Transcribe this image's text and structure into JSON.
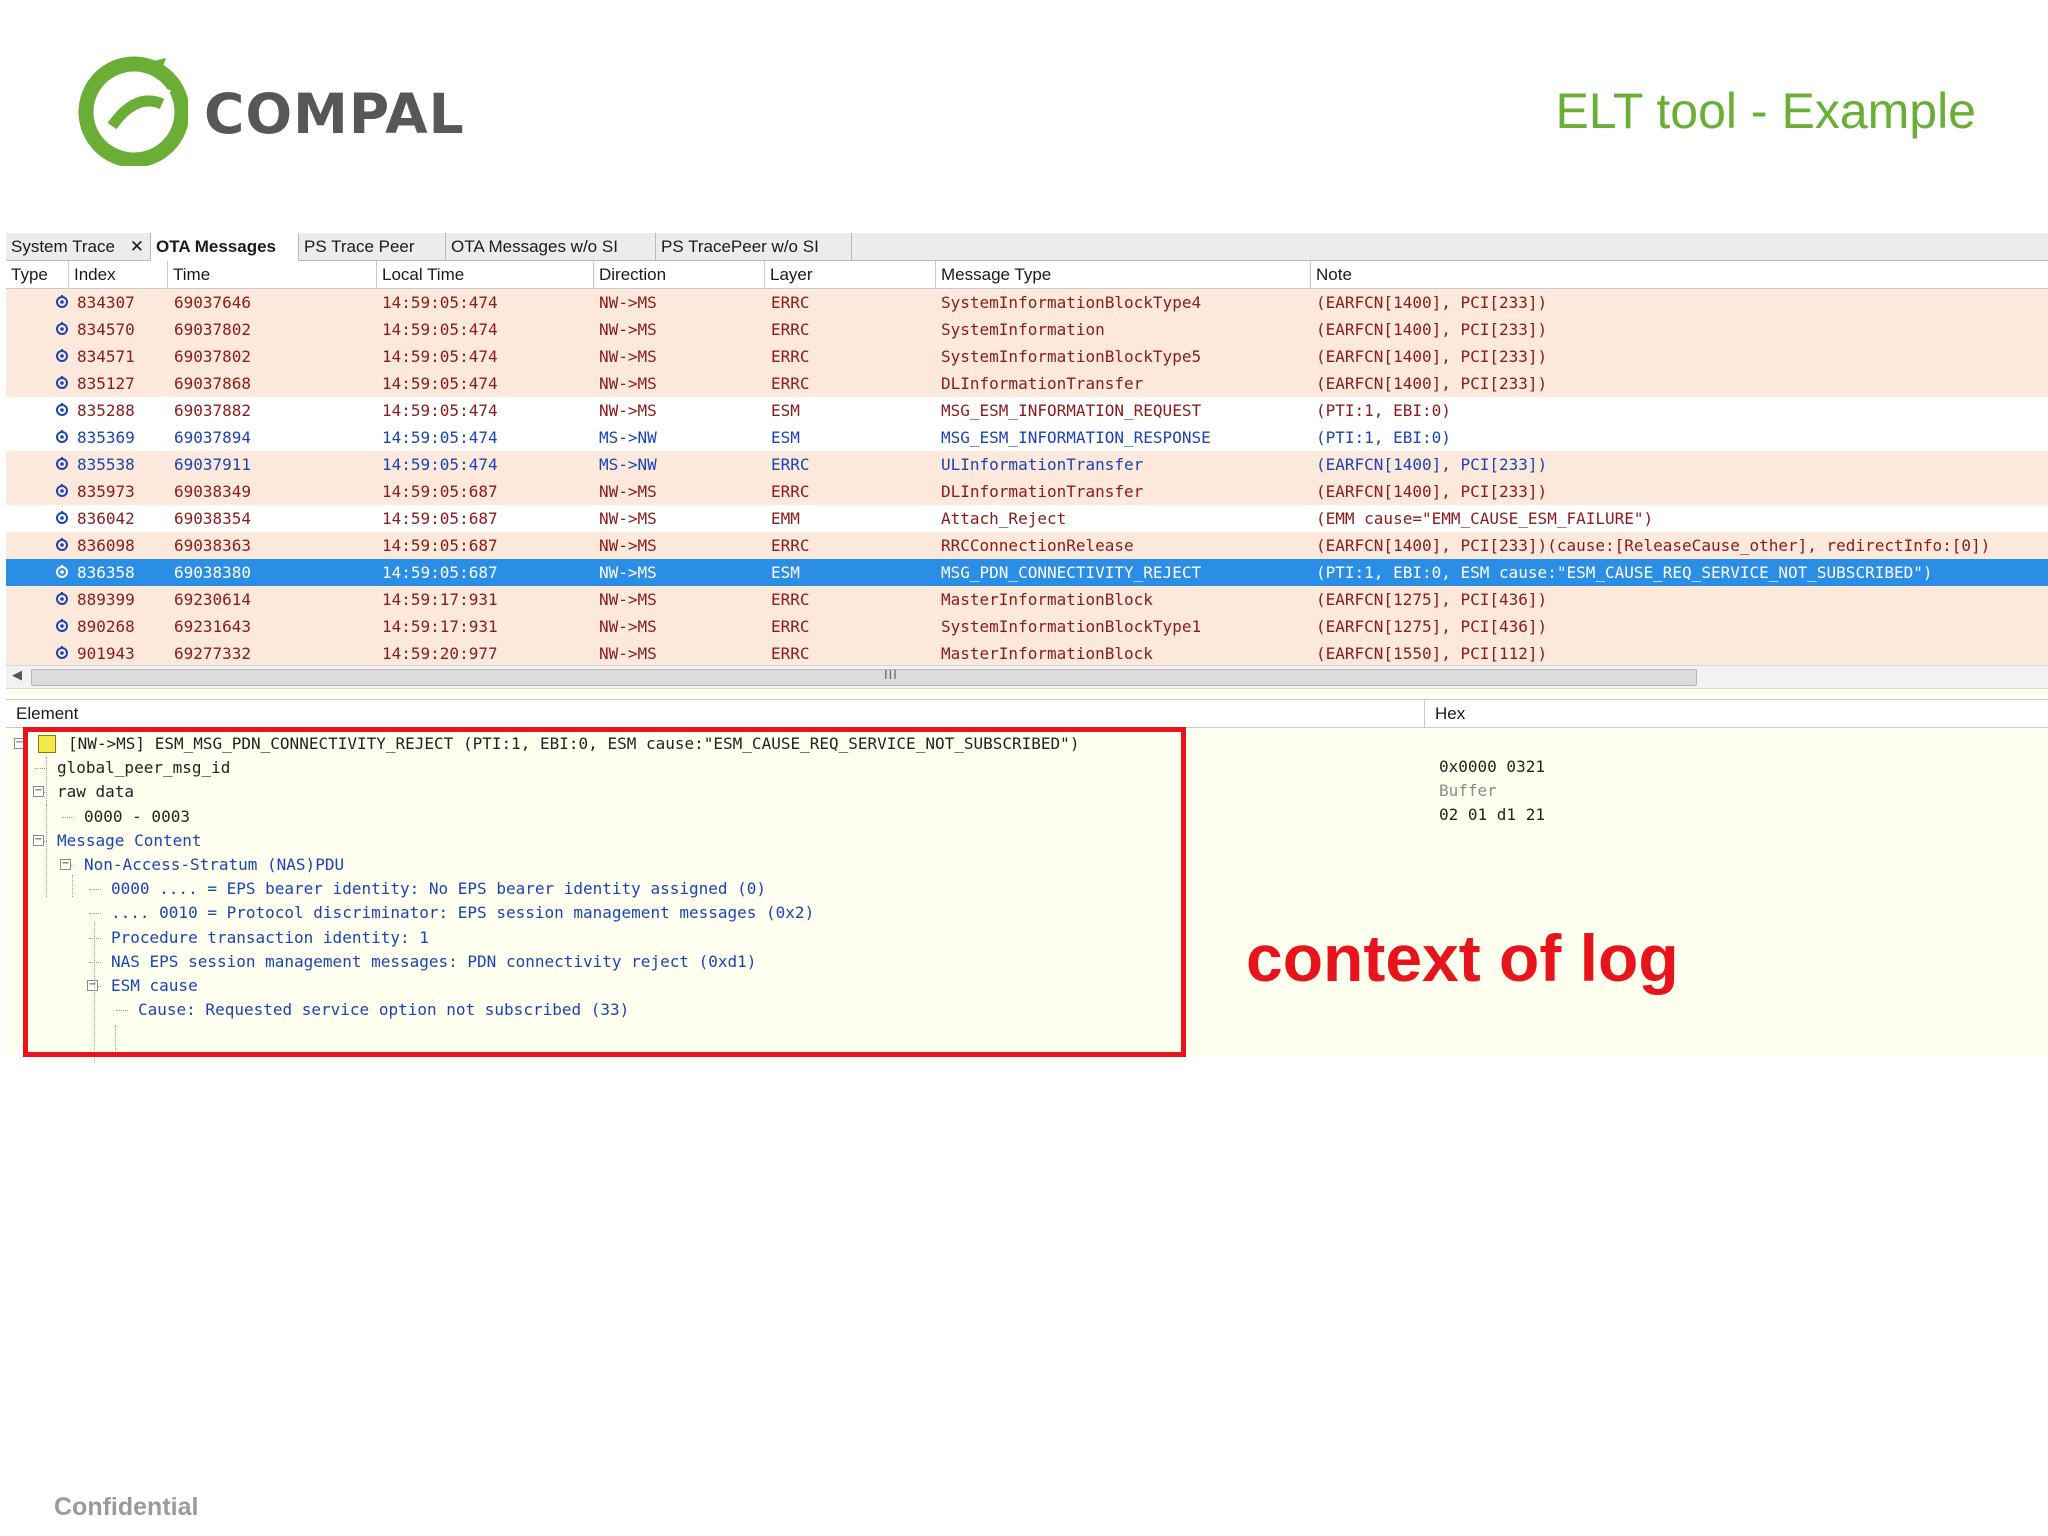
{
  "header": {
    "logo_text": "COMPAL",
    "title": "ELT tool - Example",
    "brand_color": "#6aae35"
  },
  "footer": {
    "confidential": "Confidential"
  },
  "tabs": [
    {
      "label": "System Trace",
      "active": false,
      "closable": true
    },
    {
      "label": "OTA Messages",
      "active": true
    },
    {
      "label": "PS Trace Peer",
      "active": false
    },
    {
      "label": "OTA Messages w/o SI",
      "active": false
    },
    {
      "label": "PS TracePeer w/o SI",
      "active": false
    }
  ],
  "columns": [
    "Type",
    "Index",
    "Time",
    "Local Time",
    "Direction",
    "Layer",
    "Message Type",
    "Note"
  ],
  "rows": [
    {
      "index": "834307",
      "time": "69037646",
      "local": "14:59:05:474",
      "dir": "NW->MS",
      "layer": "ERRC",
      "type": "SystemInformationBlockType4",
      "note": "(EARFCN[1400], PCI[233])",
      "style": "alt"
    },
    {
      "index": "834570",
      "time": "69037802",
      "local": "14:59:05:474",
      "dir": "NW->MS",
      "layer": "ERRC",
      "type": "SystemInformation",
      "note": "(EARFCN[1400], PCI[233])",
      "style": "alt"
    },
    {
      "index": "834571",
      "time": "69037802",
      "local": "14:59:05:474",
      "dir": "NW->MS",
      "layer": "ERRC",
      "type": "SystemInformationBlockType5",
      "note": "(EARFCN[1400], PCI[233])",
      "style": "alt"
    },
    {
      "index": "835127",
      "time": "69037868",
      "local": "14:59:05:474",
      "dir": "NW->MS",
      "layer": "ERRC",
      "type": "DLInformationTransfer",
      "note": "(EARFCN[1400], PCI[233])",
      "style": "alt"
    },
    {
      "index": "835288",
      "time": "69037882",
      "local": "14:59:05:474",
      "dir": "NW->MS",
      "layer": "ESM",
      "type": "MSG_ESM_INFORMATION_REQUEST",
      "note": "(PTI:1, EBI:0)",
      "style": "plain"
    },
    {
      "index": "835369",
      "time": "69037894",
      "local": "14:59:05:474",
      "dir": "MS->NW",
      "layer": "ESM",
      "type": "MSG_ESM_INFORMATION_RESPONSE",
      "note": "(PTI:1, EBI:0)",
      "style": "blue"
    },
    {
      "index": "835538",
      "time": "69037911",
      "local": "14:59:05:474",
      "dir": "MS->NW",
      "layer": "ERRC",
      "type": "ULInformationTransfer",
      "note": "(EARFCN[1400], PCI[233])",
      "style": "altblue"
    },
    {
      "index": "835973",
      "time": "69038349",
      "local": "14:59:05:687",
      "dir": "NW->MS",
      "layer": "ERRC",
      "type": "DLInformationTransfer",
      "note": "(EARFCN[1400], PCI[233])",
      "style": "alt"
    },
    {
      "index": "836042",
      "time": "69038354",
      "local": "14:59:05:687",
      "dir": "NW->MS",
      "layer": "EMM",
      "type": "Attach_Reject",
      "note": "(EMM cause=\"EMM_CAUSE_ESM_FAILURE\")",
      "style": "plain"
    },
    {
      "index": "836098",
      "time": "69038363",
      "local": "14:59:05:687",
      "dir": "NW->MS",
      "layer": "ERRC",
      "type": "RRCConnectionRelease",
      "note": "(EARFCN[1400], PCI[233])(cause:[ReleaseCause_other], redirectInfo:[0])",
      "style": "alt"
    },
    {
      "index": "836358",
      "time": "69038380",
      "local": "14:59:05:687",
      "dir": "NW->MS",
      "layer": "ESM",
      "type": "MSG_PDN_CONNECTIVITY_REJECT",
      "note": "(PTI:1, EBI:0, ESM cause:\"ESM_CAUSE_REQ_SERVICE_NOT_SUBSCRIBED\")",
      "style": "sel"
    },
    {
      "index": "889399",
      "time": "69230614",
      "local": "14:59:17:931",
      "dir": "NW->MS",
      "layer": "ERRC",
      "type": "MasterInformationBlock",
      "note": "(EARFCN[1275], PCI[436])",
      "style": "alt"
    },
    {
      "index": "890268",
      "time": "69231643",
      "local": "14:59:17:931",
      "dir": "NW->MS",
      "layer": "ERRC",
      "type": "SystemInformationBlockType1",
      "note": "(EARFCN[1275], PCI[436])",
      "style": "alt"
    },
    {
      "index": "901943",
      "time": "69277332",
      "local": "14:59:20:977",
      "dir": "NW->MS",
      "layer": "ERRC",
      "type": "MasterInformationBlock",
      "note": "(EARFCN[1550], PCI[112])",
      "style": "alt"
    }
  ],
  "scrollbar": {
    "grip": "III"
  },
  "detail": {
    "element_header": "Element",
    "hex_header": "Hex",
    "tree": [
      {
        "text": "[NW->MS] ESM_MSG_PDN_CONNECTIVITY_REJECT (PTI:1, EBI:0, ESM cause:\"ESM_CAUSE_REQ_SERVICE_NOT_SUBSCRIBED\")",
        "level": 0,
        "color": "dark",
        "expander": "-"
      },
      {
        "text": "global_peer_msg_id",
        "level": 1,
        "color": "dark"
      },
      {
        "text": "raw data",
        "level": 1,
        "color": "dark",
        "expander": "-"
      },
      {
        "text": "0000 - 0003",
        "level": 2,
        "color": "dark"
      },
      {
        "text": "Message Content",
        "level": 1,
        "color": "blue",
        "expander": "-"
      },
      {
        "text": "Non-Access-Stratum (NAS)PDU",
        "level": 2,
        "color": "blue",
        "expander": "-"
      },
      {
        "text": "0000 .... = EPS bearer identity: No EPS bearer identity assigned (0)",
        "level": 3,
        "color": "blue"
      },
      {
        "text": ".... 0010 = Protocol discriminator: EPS session management messages (0x2)",
        "level": 3,
        "color": "blue"
      },
      {
        "text": "Procedure transaction identity: 1",
        "level": 3,
        "color": "blue"
      },
      {
        "text": "NAS EPS session management messages: PDN connectivity reject (0xd1)",
        "level": 3,
        "color": "blue"
      },
      {
        "text": "ESM cause",
        "level": 3,
        "color": "blue",
        "expander": "-"
      },
      {
        "text": "Cause: Requested service option not subscribed (33)",
        "level": 4,
        "color": "blue"
      }
    ],
    "hex_lines": [
      {
        "text": "0x0000 0321",
        "color": "#222222"
      },
      {
        "text": "Buffer",
        "color": "#8a8a8a"
      },
      {
        "text": "02 01 d1 21",
        "color": "#222222"
      }
    ]
  },
  "annotation": {
    "text": "context of log",
    "color": "#e8141c"
  }
}
